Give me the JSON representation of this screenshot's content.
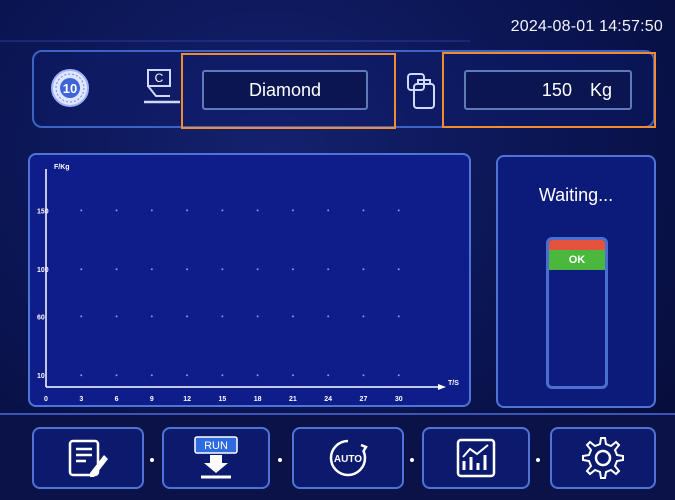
{
  "header": {
    "datetime": "2024-08-01 14:57:50"
  },
  "settings": {
    "hardness_badge": "10",
    "indenter_letter": "C",
    "indenter_value": "Diamond",
    "force_value": "150",
    "force_unit": "Kg"
  },
  "chart_data": {
    "type": "line",
    "ylabel": "F/Kg",
    "xlabel": "T/S",
    "x_ticks": [
      "0",
      "3",
      "6",
      "9",
      "12",
      "15",
      "18",
      "21",
      "24",
      "27",
      "30"
    ],
    "y_ticks": [
      "10",
      "60",
      "100",
      "150"
    ],
    "xlim": [
      0,
      33
    ],
    "ylim": [
      0,
      180
    ],
    "grid": "dots",
    "series": []
  },
  "status": {
    "text": "Waiting...",
    "ok_label": "OK"
  },
  "navbar": {
    "buttons": [
      {
        "icon": "edit-document-icon"
      },
      {
        "icon": "run-icon",
        "label": "RUN"
      },
      {
        "icon": "auto-icon",
        "label": "AUTO"
      },
      {
        "icon": "chart-icon"
      },
      {
        "icon": "gear-icon"
      }
    ]
  },
  "colors": {
    "background": "#0a1450",
    "panel_border": "#4f74d6",
    "highlight": "#f28a30",
    "ok_green": "#49b83c",
    "alarm_red": "#e5533e"
  }
}
